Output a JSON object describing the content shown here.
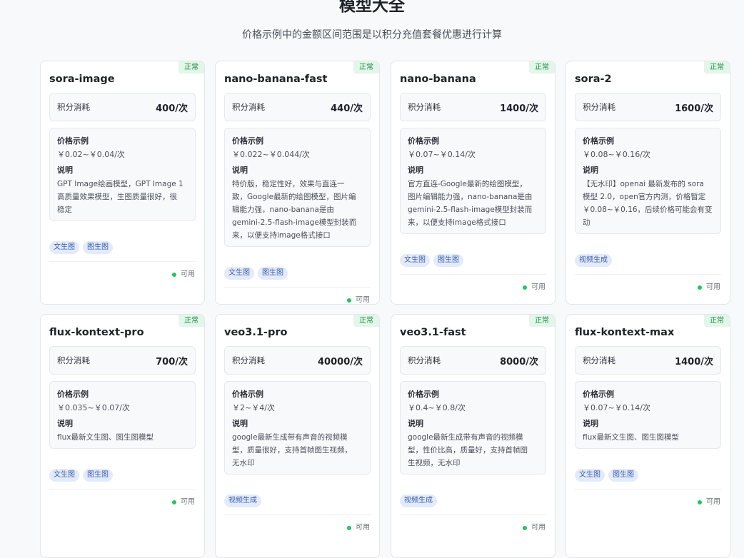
{
  "header": {
    "title": "模型大全",
    "subtitle": "价格示例中的金额区间范围是以积分充值套餐优惠进行计算"
  },
  "labels": {
    "cost_label": "积分消耗",
    "price_heading": "价格示例",
    "desc_heading": "说明",
    "available": "可用"
  },
  "colors": {
    "status_green": "#1f8a45",
    "tag_blue": "#3a5cb0",
    "available_dot": "#22c55e"
  },
  "models": [
    {
      "name": "sora-image",
      "status": "正常",
      "cost": "400/次",
      "price": "￥0.02~￥0.04/次",
      "description_lines": [
        "GPT Image绘画模型，GPT Image 1",
        "高质量效果模型，生图质量很好，很",
        "稳定"
      ],
      "tags": [
        "文生图",
        "图生图"
      ]
    },
    {
      "name": "nano-banana-fast",
      "status": "正常",
      "cost": "440/次",
      "price": "￥0.022~￥0.044/次",
      "description_lines": [
        "特价版，稳定性好，效果与直连一",
        "致，Google最新的绘图模型，图片编",
        "辑能力强，nano-banana是由",
        "gemini-2.5-flash-image模型封装而",
        "来，以便支持image格式接口"
      ],
      "tags": [
        "文生图",
        "图生图"
      ]
    },
    {
      "name": "nano-banana",
      "status": "正常",
      "cost": "1400/次",
      "price": "￥0.07~￥0.14/次",
      "description_lines": [
        "官方直连-Google最新的绘图模型，",
        "图片编辑能力强，nano-banana是由",
        "gemini-2.5-flash-image模型封装而",
        "来，以便支持image格式接口"
      ],
      "tags": [
        "文生图",
        "图生图"
      ]
    },
    {
      "name": "sora-2",
      "status": "正常",
      "cost": "1600/次",
      "price": "￥0.08~￥0.16/次",
      "description_lines": [
        "【无水印】openai 最新发布的 sora",
        "模型 2.0，open官方内测，价格暂定",
        "￥0.08~￥0.16，后续价格可能会有变",
        "动"
      ],
      "tags": [
        "视频生成"
      ]
    },
    {
      "name": "flux-kontext-pro",
      "status": "正常",
      "cost": "700/次",
      "price": "￥0.035~￥0.07/次",
      "description_lines": [
        "flux最新文生图、图生图模型"
      ],
      "tags": [
        "文生图",
        "图生图"
      ]
    },
    {
      "name": "veo3.1-pro",
      "status": "正常",
      "cost": "40000/次",
      "price": "￥2~￥4/次",
      "description_lines": [
        "google最新生成带有声音的视频模",
        "型，质量很好，支持首帧图生视频，",
        "无水印"
      ],
      "tags": [
        "视频生成"
      ]
    },
    {
      "name": "veo3.1-fast",
      "status": "正常",
      "cost": "8000/次",
      "price": "￥0.4~￥0.8/次",
      "description_lines": [
        "google最新生成带有声音的视频模",
        "型，性价比高，质量好，支持首帧图",
        "生视频，无水印"
      ],
      "tags": [
        "视频生成"
      ]
    },
    {
      "name": "flux-kontext-max",
      "status": "正常",
      "cost": "1400/次",
      "price": "￥0.07~￥0.14/次",
      "description_lines": [
        "flux最新文生图、图生图模型"
      ],
      "tags": [
        "文生图",
        "图生图"
      ]
    }
  ]
}
